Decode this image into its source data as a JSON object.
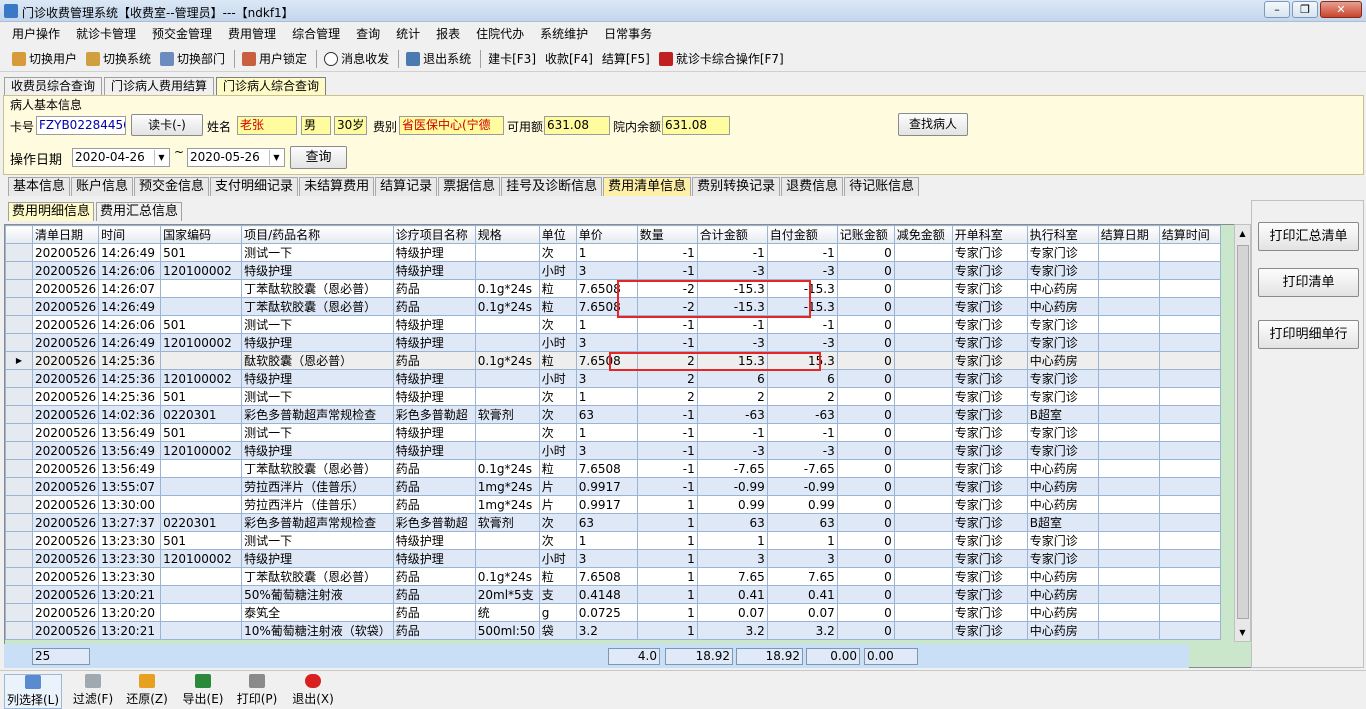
{
  "window": {
    "title": "门诊收费管理系统【收费室--管理员】---【ndkf1】"
  },
  "menu": [
    "用户操作",
    "就诊卡管理",
    "预交金管理",
    "费用管理",
    "综合管理",
    "查询",
    "统计",
    "报表",
    "住院代办",
    "系统维护",
    "日常事务"
  ],
  "toolbar": {
    "switch_user": "切换用户",
    "switch_system": "切换系统",
    "switch_dept": "切换部门",
    "lock_user": "用户锁定",
    "messages": "消息收发",
    "exit_system": "退出系统",
    "create_card": "建卡[F3]",
    "receive": "收款[F4]",
    "settle": "结算[F5]",
    "card_ops": "就诊卡综合操作[F7]"
  },
  "form_tabs": [
    "收费员综合查询",
    "门诊病人费用结算",
    "门诊病人综合查询"
  ],
  "patient": {
    "section_title": "病人基本信息",
    "card_label": "卡号",
    "card_no": "FZYB02284456",
    "read_card": "读卡(-)",
    "name_label": "姓名",
    "name": "老张",
    "sex": "男",
    "age": "30岁",
    "fee_type_label": "费别",
    "fee_type": "省医保中心(宁德",
    "available_label": "可用额",
    "available": "631.08",
    "balance_label": "院内余额",
    "balance": "631.08",
    "find_button": "查找病人",
    "op_date_label": "操作日期",
    "date_from": "2020-04-26",
    "date_sep": "~",
    "date_to": "2020-05-26",
    "query_button": "查询"
  },
  "main_tabs": [
    "基本信息",
    "账户信息",
    "预交金信息",
    "支付明细记录",
    "未结算费用",
    "结算记录",
    "票据信息",
    "挂号及诊断信息",
    "费用清单信息",
    "费别转换记录",
    "退费信息",
    "待记账信息"
  ],
  "sub_tabs": [
    "费用明细信息",
    "费用汇总信息"
  ],
  "grid": {
    "columns": [
      "清单日期",
      "时间",
      "国家编码",
      "项目/药品名称",
      "诊疗项目名称",
      "规格",
      "单位",
      "单价",
      "数量",
      "合计金额",
      "自付金额",
      "记账金额",
      "减免金额",
      "开单科室",
      "执行科室",
      "结算日期",
      "结算时间"
    ],
    "rows": [
      [
        "20200526",
        "14:26:49",
        "501",
        "测试一下",
        "特级护理",
        "",
        "次",
        "1",
        "-1",
        "-1",
        "-1",
        "0",
        "",
        "专家门诊",
        "专家门诊",
        "",
        ""
      ],
      [
        "20200526",
        "14:26:06",
        "120100002",
        "特级护理",
        "特级护理",
        "",
        "小时",
        "3",
        "-1",
        "-3",
        "-3",
        "0",
        "",
        "专家门诊",
        "专家门诊",
        "",
        ""
      ],
      [
        "20200526",
        "14:26:07",
        "",
        "丁苯酞软胶囊（恩必普）",
        "药品",
        "0.1g*24s",
        "粒",
        "7.6508",
        "-2",
        "-15.3",
        "-15.3",
        "0",
        "",
        "专家门诊",
        "中心药房",
        "",
        ""
      ],
      [
        "20200526",
        "14:26:49",
        "",
        "丁苯酞软胶囊（恩必普）",
        "药品",
        "0.1g*24s",
        "粒",
        "7.6508",
        "-2",
        "-15.3",
        "-15.3",
        "0",
        "",
        "专家门诊",
        "中心药房",
        "",
        ""
      ],
      [
        "20200526",
        "14:26:06",
        "501",
        "测试一下",
        "特级护理",
        "",
        "次",
        "1",
        "-1",
        "-1",
        "-1",
        "0",
        "",
        "专家门诊",
        "专家门诊",
        "",
        ""
      ],
      [
        "20200526",
        "14:26:49",
        "120100002",
        "特级护理",
        "特级护理",
        "",
        "小时",
        "3",
        "-1",
        "-3",
        "-3",
        "0",
        "",
        "专家门诊",
        "专家门诊",
        "",
        ""
      ],
      [
        "20200526",
        "14:25:36",
        "",
        "酞软胶囊（恩必普）",
        "药品",
        "0.1g*24s",
        "粒",
        "7.6508",
        "2",
        "15.3",
        "15.3",
        "0",
        "",
        "专家门诊",
        "中心药房",
        "",
        ""
      ],
      [
        "20200526",
        "14:25:36",
        "120100002",
        "特级护理",
        "特级护理",
        "",
        "小时",
        "3",
        "2",
        "6",
        "6",
        "0",
        "",
        "专家门诊",
        "专家门诊",
        "",
        ""
      ],
      [
        "20200526",
        "14:25:36",
        "501",
        "测试一下",
        "特级护理",
        "",
        "次",
        "1",
        "2",
        "2",
        "2",
        "0",
        "",
        "专家门诊",
        "专家门诊",
        "",
        ""
      ],
      [
        "20200526",
        "14:02:36",
        "0220301",
        "彩色多普勒超声常规检查",
        "彩色多普勒超",
        "软膏剂",
        "次",
        "63",
        "-1",
        "-63",
        "-63",
        "0",
        "",
        "专家门诊",
        "B超室",
        "",
        ""
      ],
      [
        "20200526",
        "13:56:49",
        "501",
        "测试一下",
        "特级护理",
        "",
        "次",
        "1",
        "-1",
        "-1",
        "-1",
        "0",
        "",
        "专家门诊",
        "专家门诊",
        "",
        ""
      ],
      [
        "20200526",
        "13:56:49",
        "120100002",
        "特级护理",
        "特级护理",
        "",
        "小时",
        "3",
        "-1",
        "-3",
        "-3",
        "0",
        "",
        "专家门诊",
        "专家门诊",
        "",
        ""
      ],
      [
        "20200526",
        "13:56:49",
        "",
        "丁苯酞软胶囊（恩必普）",
        "药品",
        "0.1g*24s",
        "粒",
        "7.6508",
        "-1",
        "-7.65",
        "-7.65",
        "0",
        "",
        "专家门诊",
        "中心药房",
        "",
        ""
      ],
      [
        "20200526",
        "13:55:07",
        "",
        "劳拉西泮片（佳普乐）",
        "药品",
        "1mg*24s",
        "片",
        "0.9917",
        "-1",
        "-0.99",
        "-0.99",
        "0",
        "",
        "专家门诊",
        "中心药房",
        "",
        ""
      ],
      [
        "20200526",
        "13:30:00",
        "",
        "劳拉西泮片（佳普乐）",
        "药品",
        "1mg*24s",
        "片",
        "0.9917",
        "1",
        "0.99",
        "0.99",
        "0",
        "",
        "专家门诊",
        "中心药房",
        "",
        ""
      ],
      [
        "20200526",
        "13:27:37",
        "0220301",
        "彩色多普勒超声常规检查",
        "彩色多普勒超",
        "软膏剂",
        "次",
        "63",
        "1",
        "63",
        "63",
        "0",
        "",
        "专家门诊",
        "B超室",
        "",
        ""
      ],
      [
        "20200526",
        "13:23:30",
        "501",
        "测试一下",
        "特级护理",
        "",
        "次",
        "1",
        "1",
        "1",
        "1",
        "0",
        "",
        "专家门诊",
        "专家门诊",
        "",
        ""
      ],
      [
        "20200526",
        "13:23:30",
        "120100002",
        "特级护理",
        "特级护理",
        "",
        "小时",
        "3",
        "1",
        "3",
        "3",
        "0",
        "",
        "专家门诊",
        "专家门诊",
        "",
        ""
      ],
      [
        "20200526",
        "13:23:30",
        "",
        "丁苯酞软胶囊（恩必普）",
        "药品",
        "0.1g*24s",
        "粒",
        "7.6508",
        "1",
        "7.65",
        "7.65",
        "0",
        "",
        "专家门诊",
        "中心药房",
        "",
        ""
      ],
      [
        "20200526",
        "13:20:21",
        "",
        "50%葡萄糖注射液",
        "药品",
        "20ml*5支",
        "支",
        "0.4148",
        "1",
        "0.41",
        "0.41",
        "0",
        "",
        "专家门诊",
        "中心药房",
        "",
        ""
      ],
      [
        "20200526",
        "13:20:20",
        "",
        "泰笂全",
        "药品",
        "统",
        "g",
        "0.0725",
        "1",
        "0.07",
        "0.07",
        "0",
        "",
        "专家门诊",
        "中心药房",
        "",
        ""
      ],
      [
        "20200526",
        "13:20:21",
        "",
        "10%葡萄糖注射液（软袋）",
        "药品",
        "500ml:50",
        "袋",
        "3.2",
        "1",
        "3.2",
        "3.2",
        "0",
        "",
        "专家门诊",
        "中心药房",
        "",
        ""
      ]
    ],
    "footer": {
      "count": "25",
      "qty": "4.0",
      "total": "18.92",
      "self_pay": "18.92",
      "account": "0.00",
      "reduce": "0.00"
    }
  },
  "right_panel": {
    "print_summary": "打印汇总清单",
    "print_list": "打印清单",
    "print_detail_row": "打印明细单行"
  },
  "bottom": {
    "column_select": "列选择(L)",
    "filter": "过滤(F)",
    "restore": "还原(Z)",
    "export": "导出(E)",
    "print": "打印(P)",
    "exit": "退出(X)"
  }
}
